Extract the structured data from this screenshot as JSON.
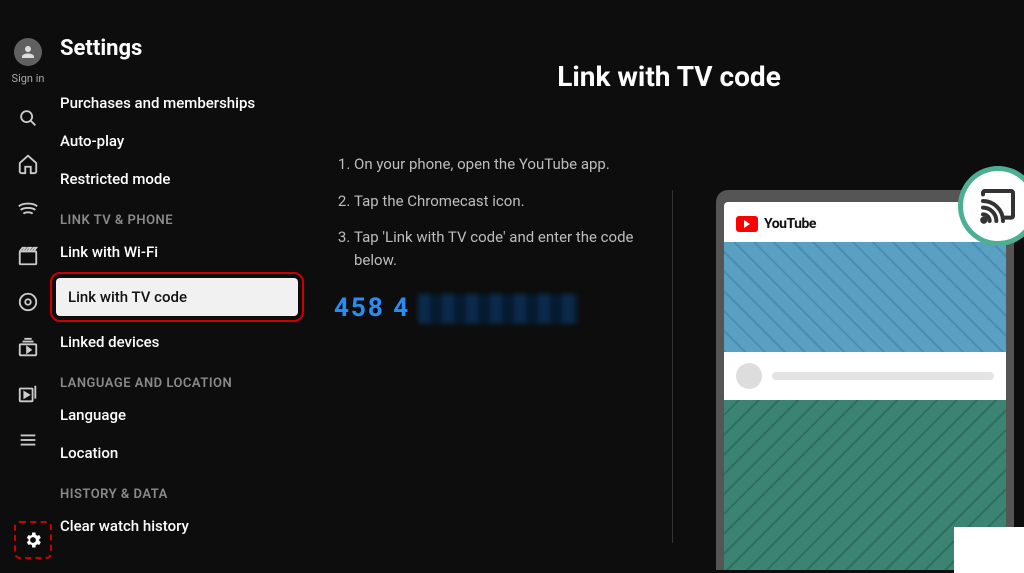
{
  "signin": "Sign in",
  "page_title": "Settings",
  "menu": {
    "purchases": "Purchases and memberships",
    "autoplay": "Auto-play",
    "restricted": "Restricted mode",
    "section_link": "LINK TV & PHONE",
    "wifi": "Link with Wi-Fi",
    "tvcode": "Link with TV code",
    "linked": "Linked devices",
    "section_lang": "LANGUAGE AND LOCATION",
    "language": "Language",
    "location": "Location",
    "section_history": "HISTORY & DATA",
    "clear_history": "Clear watch history"
  },
  "content": {
    "heading": "Link with TV code",
    "step1": "On your phone, open the YouTube app.",
    "step2": "Tap the Chromecast icon.",
    "step3": "Tap 'Link with TV code' and enter the code below.",
    "code_visible": "458 4"
  },
  "illustration": {
    "brand": "YouTube"
  }
}
